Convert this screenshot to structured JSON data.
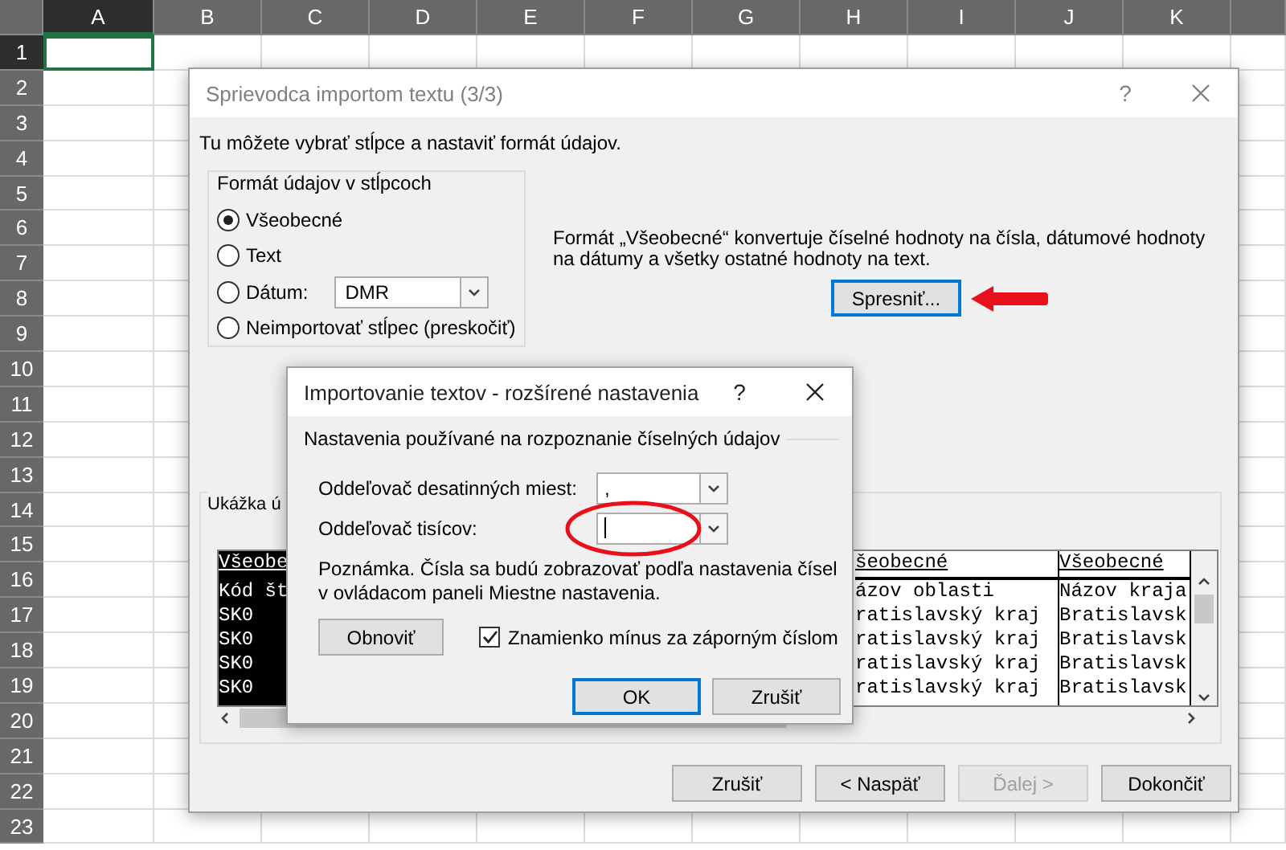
{
  "spreadsheet": {
    "columns": [
      {
        "label": "A",
        "selected": true
      },
      {
        "label": "B",
        "selected": false
      },
      {
        "label": "C",
        "selected": false
      },
      {
        "label": "D",
        "selected": false
      },
      {
        "label": "E",
        "selected": false
      },
      {
        "label": "F",
        "selected": false
      },
      {
        "label": "G",
        "selected": false
      },
      {
        "label": "H",
        "selected": false
      },
      {
        "label": "I",
        "selected": false
      },
      {
        "label": "J",
        "selected": false
      },
      {
        "label": "K",
        "selected": false
      }
    ],
    "rows": [
      {
        "label": "1",
        "selected": true
      },
      {
        "label": "2",
        "selected": false
      },
      {
        "label": "3",
        "selected": false
      },
      {
        "label": "4",
        "selected": false
      },
      {
        "label": "5",
        "selected": false
      },
      {
        "label": "6",
        "selected": false
      },
      {
        "label": "7",
        "selected": false
      },
      {
        "label": "8",
        "selected": false
      },
      {
        "label": "9",
        "selected": false
      },
      {
        "label": "10",
        "selected": false
      },
      {
        "label": "11",
        "selected": false
      },
      {
        "label": "12",
        "selected": false
      },
      {
        "label": "13",
        "selected": false
      },
      {
        "label": "14",
        "selected": false
      },
      {
        "label": "15",
        "selected": false
      },
      {
        "label": "16",
        "selected": false
      },
      {
        "label": "17",
        "selected": false
      },
      {
        "label": "18",
        "selected": false
      },
      {
        "label": "19",
        "selected": false
      },
      {
        "label": "20",
        "selected": false
      },
      {
        "label": "21",
        "selected": false
      },
      {
        "label": "22",
        "selected": false
      },
      {
        "label": "23",
        "selected": false
      }
    ]
  },
  "wizard": {
    "title": "Sprievodca importom textu (3/3)",
    "help": "?",
    "intro": "Tu môžete vybrať stĺpce a nastaviť formát údajov.",
    "format_group": {
      "title": "Formát údajov v stĺpcoch",
      "options": [
        {
          "kind": "radio",
          "label": "Všeobecné",
          "selected": true
        },
        {
          "kind": "radio",
          "label": "Text",
          "selected": false
        },
        {
          "kind": "radio-dropdown",
          "label": "Dátum:",
          "selected": false,
          "value": "DMR"
        },
        {
          "kind": "radio",
          "label": "Neimportovať stĺpec (preskočiť)",
          "selected": false
        }
      ]
    },
    "description": "Formát „Všeobecné“ konvertuje číselné hodnoty na čísla, dátumové hodnoty na dátumy a všetky ostatné hodnoty na text.",
    "advanced_button": "Spresniť...",
    "preview": {
      "label": "Ukážka ú",
      "columns": [
        {
          "selected": true,
          "header": "Všeobe",
          "cells": [
            "Kód št",
            "SK0",
            "SK0",
            "SK0",
            "SK0"
          ]
        },
        {
          "selected": false,
          "header": "šeobecné",
          "cells": [
            "ázov oblasti",
            "ratislavský kraj",
            "ratislavský kraj",
            "ratislavský kraj",
            "ratislavský kraj"
          ]
        },
        {
          "selected": false,
          "header": "Všeobecné",
          "cells": [
            "Názov kraja",
            "Bratislavsk",
            "Bratislavsk",
            "Bratislavsk",
            "Bratislavsk"
          ]
        }
      ]
    },
    "buttons": [
      {
        "label": "Zrušiť",
        "disabled": false
      },
      {
        "label": "< Naspäť",
        "disabled": false
      },
      {
        "label": "Ďalej >",
        "disabled": true
      },
      {
        "label": "Dokončiť",
        "disabled": false
      }
    ]
  },
  "advanced_dialog": {
    "title": "Importovanie textov - rozšírené nastavenia",
    "help": "?",
    "group_title": "Nastavenia používané na rozpoznanie číselných údajov",
    "fields": [
      {
        "label": "Oddeľovač desatinných miest:",
        "value": ",",
        "focused": false
      },
      {
        "label": "Oddeľovač tisícov:",
        "focused": true
      }
    ],
    "note": "Poznámka. Čísla sa budú zobrazovať podľa nastavenia čísel v ovládacom paneli Miestne nastavenia.",
    "reset_button": "Obnoviť",
    "checkbox": {
      "label": "Znamienko mínus za záporným číslom",
      "checked": true
    },
    "buttons": [
      {
        "label": "OK",
        "default": true
      },
      {
        "label": "Zrušiť",
        "default": false
      }
    ]
  }
}
